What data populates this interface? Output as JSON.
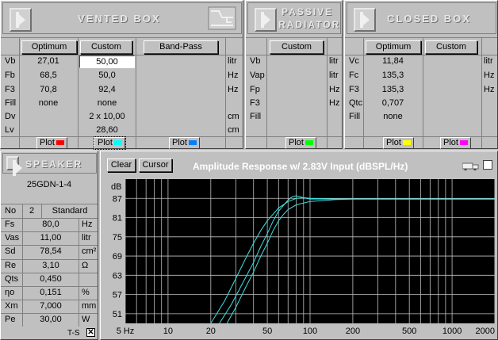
{
  "vented": {
    "title": "VENTED BOX",
    "buttons": [
      "Optimum",
      "Custom",
      "Band-Pass"
    ],
    "rows": [
      {
        "label": "Vb",
        "opt": "27,01",
        "custom": "50,00",
        "bp": "",
        "unit": "litr"
      },
      {
        "label": "Fb",
        "opt": "68,5",
        "custom": "50,0",
        "bp": "",
        "unit": "Hz"
      },
      {
        "label": "F3",
        "opt": "70,8",
        "custom": "92,4",
        "bp": "",
        "unit": "Hz"
      },
      {
        "label": "Fill",
        "opt": "none",
        "custom": "none",
        "bp": "",
        "unit": ""
      },
      {
        "label": "Dv",
        "opt": "",
        "custom": "2 x 10,00",
        "bp": "",
        "unit": "cm"
      },
      {
        "label": "Lv",
        "opt": "",
        "custom": "28,60",
        "bp": "",
        "unit": "cm"
      }
    ],
    "plot_label": "Plot"
  },
  "passive": {
    "title_line1": "PASSIVE",
    "title_line2": "RADIATOR",
    "button": "Custom",
    "rows": [
      {
        "label": "Vb",
        "unit": "litr"
      },
      {
        "label": "Vap",
        "unit": "litr"
      },
      {
        "label": "Fp",
        "unit": "Hz"
      },
      {
        "label": "F3",
        "unit": "Hz"
      },
      {
        "label": "Fill",
        "unit": ""
      }
    ],
    "plot_label": "Plot"
  },
  "closed": {
    "title": "CLOSED BOX",
    "buttons": [
      "Optimum",
      "Custom"
    ],
    "rows": [
      {
        "label": "Vc",
        "opt": "11,84",
        "unit": "litr"
      },
      {
        "label": "Fc",
        "opt": "135,3",
        "unit": "Hz"
      },
      {
        "label": "F3",
        "opt": "135,3",
        "unit": "Hz"
      },
      {
        "label": "Qtc",
        "opt": "0,707",
        "unit": ""
      },
      {
        "label": "Fill",
        "opt": "none",
        "unit": ""
      }
    ],
    "plot_label": "Plot"
  },
  "speaker": {
    "title": "SPEAKER",
    "model": "25GDN-1-4",
    "no_label": "No",
    "no_value": "2",
    "mode": "Standard",
    "params": [
      {
        "label": "Fs",
        "value": "80,0",
        "unit": "Hz"
      },
      {
        "label": "Vas",
        "value": "11,00",
        "unit": "litr"
      },
      {
        "label": "Sd",
        "value": "78,54",
        "unit": "cm²"
      },
      {
        "label": "Re",
        "value": "3,10",
        "unit": "Ω"
      },
      {
        "label": "Qts",
        "value": "0,450",
        "unit": ""
      },
      {
        "label": "ηo",
        "value": "0,151",
        "unit": "%"
      },
      {
        "label": "Xm",
        "value": "7,000",
        "unit": "mm"
      },
      {
        "label": "Pe",
        "value": "30,00",
        "unit": "W"
      }
    ],
    "ts_label": "T-S",
    "ts_checked": "✕"
  },
  "chart_toolbar": {
    "clear": "Clear",
    "cursor": "Cursor",
    "title": "Amplitude Response w/ 2.83V Input (dBSPL/Hz)"
  },
  "colors": {
    "vented_plot1": "#ff0000",
    "vented_plot2": "#00ffff",
    "vented_plot3": "#0080ff",
    "passive_plot": "#00ff00",
    "closed_plot1": "#ffff00",
    "closed_plot2": "#ff00ff"
  },
  "chart_data": {
    "type": "line",
    "title": "Amplitude Response w/ 2.83V Input (dBSPL/Hz)",
    "xlabel": "Hz",
    "ylabel": "dB",
    "x_scale": "log",
    "xlim": [
      5,
      2000
    ],
    "ylim": [
      48,
      93
    ],
    "x_ticks": [
      {
        "v": 5,
        "t": "5 Hz"
      },
      {
        "v": 10,
        "t": "10"
      },
      {
        "v": 20,
        "t": "20"
      },
      {
        "v": 50,
        "t": "50"
      },
      {
        "v": 100,
        "t": "100"
      },
      {
        "v": 200,
        "t": "200"
      },
      {
        "v": 500,
        "t": "500"
      },
      {
        "v": 1000,
        "t": "1000"
      },
      {
        "v": 2000,
        "t": "2000"
      }
    ],
    "y_ticks": [
      51,
      57,
      63,
      69,
      75,
      81,
      87
    ],
    "series": [
      {
        "color": "#40e0e0",
        "x": [
          20,
          25,
          30,
          35,
          40,
          45,
          50,
          60,
          70,
          80,
          90,
          100,
          150,
          200,
          500,
          2000
        ],
        "y": [
          48,
          55,
          62,
          68,
          73,
          77,
          80,
          84,
          86,
          87,
          87.2,
          87,
          86.8,
          86.8,
          86.8,
          86.8
        ]
      },
      {
        "color": "#40e0e0",
        "x": [
          23,
          28,
          33,
          40,
          45,
          50,
          55,
          60,
          70,
          75,
          80,
          90,
          100,
          150,
          500,
          2000
        ],
        "y": [
          48,
          54,
          60,
          67,
          72,
          76,
          80,
          83,
          86.5,
          87.5,
          87.8,
          87.2,
          86.8,
          86.8,
          86.8,
          86.8
        ]
      },
      {
        "color": "#40e0e0",
        "x": [
          26,
          30,
          35,
          40,
          45,
          50,
          55,
          60,
          65,
          70,
          80,
          100,
          150,
          200,
          500
        ],
        "y": [
          48,
          53,
          59,
          64,
          69,
          73,
          77,
          80,
          82,
          83.5,
          85,
          86,
          86.6,
          86.8,
          86.8
        ]
      }
    ]
  }
}
